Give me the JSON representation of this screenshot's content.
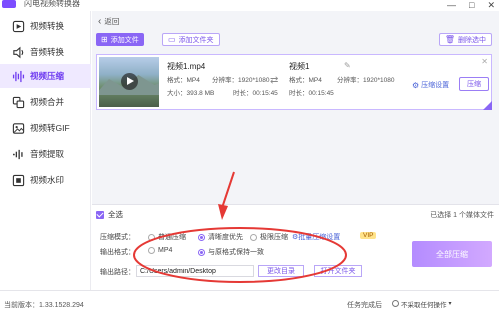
{
  "app": {
    "title": "闪电视频转换器"
  },
  "window_controls": {
    "minimize": "—",
    "maximize": "□",
    "close": "✕"
  },
  "sidebar": {
    "items": [
      {
        "label": "视频转换",
        "icon": "video-convert-icon"
      },
      {
        "label": "音频转换",
        "icon": "audio-convert-icon"
      },
      {
        "label": "视频压缩",
        "icon": "video-compress-icon",
        "active": true
      },
      {
        "label": "视频合并",
        "icon": "video-merge-icon"
      },
      {
        "label": "视频转GIF",
        "icon": "gif-icon"
      },
      {
        "label": "音频提取",
        "icon": "audio-extract-icon"
      },
      {
        "label": "视频水印",
        "icon": "watermark-icon"
      }
    ]
  },
  "toolbar": {
    "back": "返回",
    "add_file": "添加文件",
    "add_folder": "添加文件夹",
    "delete_selected": "删除选中"
  },
  "file": {
    "source": {
      "name": "视频1.mp4",
      "format": "格式：MP4",
      "resolution": "分辨率：1920*1080",
      "size": "大小：393.8 MB",
      "duration": "时长：00:15:45"
    },
    "output": {
      "name": "视频1",
      "format": "格式：MP4",
      "resolution": "分辨率：1920*1080",
      "duration": "时长：00:15:45"
    },
    "compress_settings": "压缩设置",
    "compress_button": "压缩"
  },
  "bottom": {
    "select_all": "全选",
    "selected_count": "已选择 1 个媒体文件",
    "mode_label": "压缩模式：",
    "mode_options": [
      "普通压缩",
      "清晰度优先",
      "极限压缩"
    ],
    "mode_selected": 1,
    "batch_settings": "批量压缩设置",
    "vip": "VIP",
    "format_label": "输出格式：",
    "format_options": [
      "MP4",
      "与原格式保持一致"
    ],
    "format_selected": 1,
    "path_label": "输出路径：",
    "path_value": "C:/Users/admin/Desktop",
    "change_dir": "更改目录",
    "open_folder": "打开文件夹",
    "compress_all": "全部压缩"
  },
  "status": {
    "version": "当前版本：1.33.1528.294",
    "after_task_label": "任务完成后",
    "after_task_value": "不采取任何操作"
  },
  "colors": {
    "accent": "#8a66f5",
    "annotation": "#e53935"
  }
}
